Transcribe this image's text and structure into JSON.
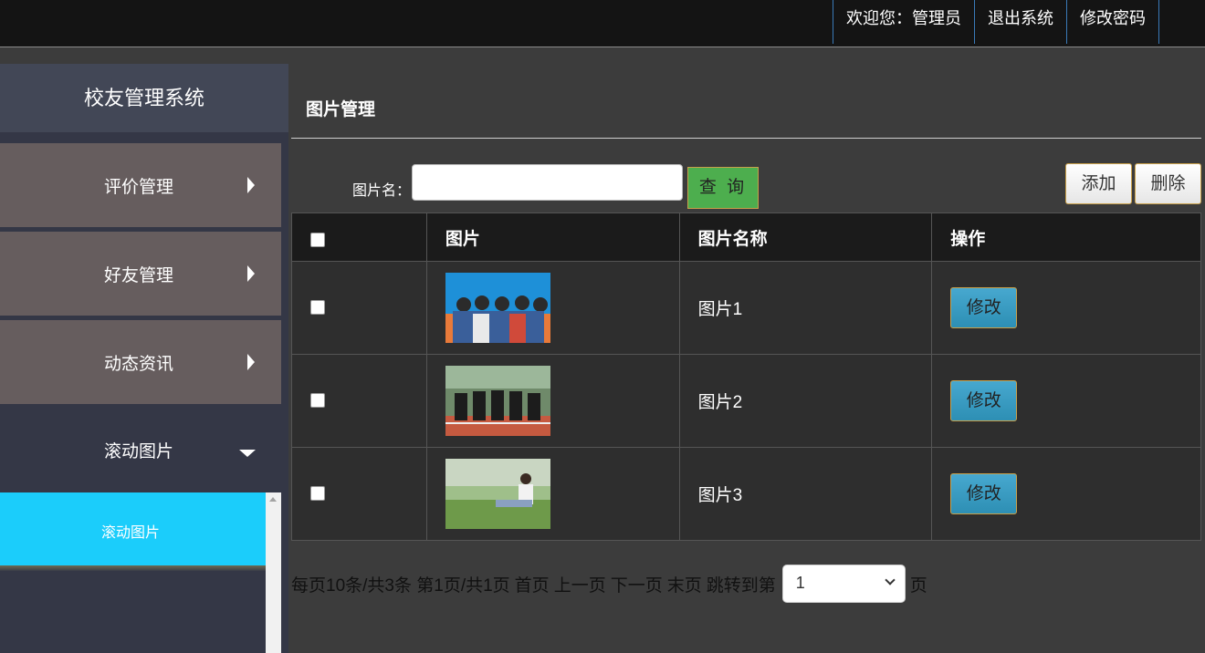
{
  "topnav": {
    "welcome": "欢迎您：管理员",
    "logout": "退出系统",
    "change_password": "修改密码"
  },
  "sidebar": {
    "brand": "校友管理系统",
    "items": [
      {
        "label": "评价管理"
      },
      {
        "label": "好友管理"
      },
      {
        "label": "动态资讯"
      }
    ],
    "open_item": {
      "label": "滚动图片"
    },
    "sub_item": {
      "label": "滚动图片"
    }
  },
  "main": {
    "title": "图片管理",
    "search_label": "图片名：",
    "search_value": "",
    "query_button": "查 询",
    "add_button": "添加",
    "delete_button": "删除",
    "table": {
      "headers": [
        "",
        "图片",
        "图片名称",
        "操作"
      ],
      "rows": [
        {
          "name": "图片1",
          "action": "修改"
        },
        {
          "name": "图片2",
          "action": "修改"
        },
        {
          "name": "图片3",
          "action": "修改"
        }
      ]
    },
    "pager": {
      "info": "每页10条/共3条 第1页/共1页",
      "first": "首页",
      "prev": "上一页",
      "next": "下一页",
      "last": "末页",
      "jump_label": "跳转到第",
      "selected_page": "1",
      "page_suffix": "页"
    }
  }
}
